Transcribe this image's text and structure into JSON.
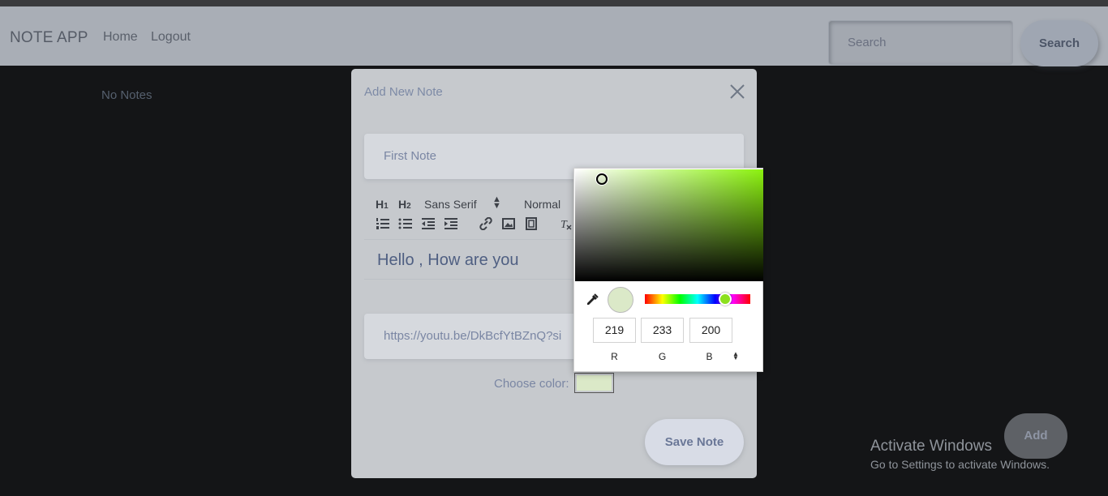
{
  "navbar": {
    "brand": "NOTE APP",
    "links": [
      "Home",
      "Logout"
    ],
    "search_placeholder": "Search",
    "search_button": "Search"
  },
  "main": {
    "empty_message": "No Notes"
  },
  "modal": {
    "title": "Add New Note",
    "note_title_value": "First Note",
    "toolbar": {
      "h1": "H1",
      "h2": "H2",
      "font": "Sans Serif",
      "size": "Normal"
    },
    "editor_content": "Hello , How are you",
    "url_value": "https://youtu.be/DkBcfYtBZnQ?si",
    "color_label": "Choose color:",
    "color_value": "#dbe9c8",
    "save_button": "Save Note"
  },
  "color_picker": {
    "r": "219",
    "g": "233",
    "b": "200",
    "r_label": "R",
    "g_label": "G",
    "b_label": "B",
    "hue_color": "#8cf20f"
  },
  "add_button": "Add",
  "watermark": {
    "title": "Activate Windows",
    "subtitle": "Go to Settings to activate Windows."
  }
}
